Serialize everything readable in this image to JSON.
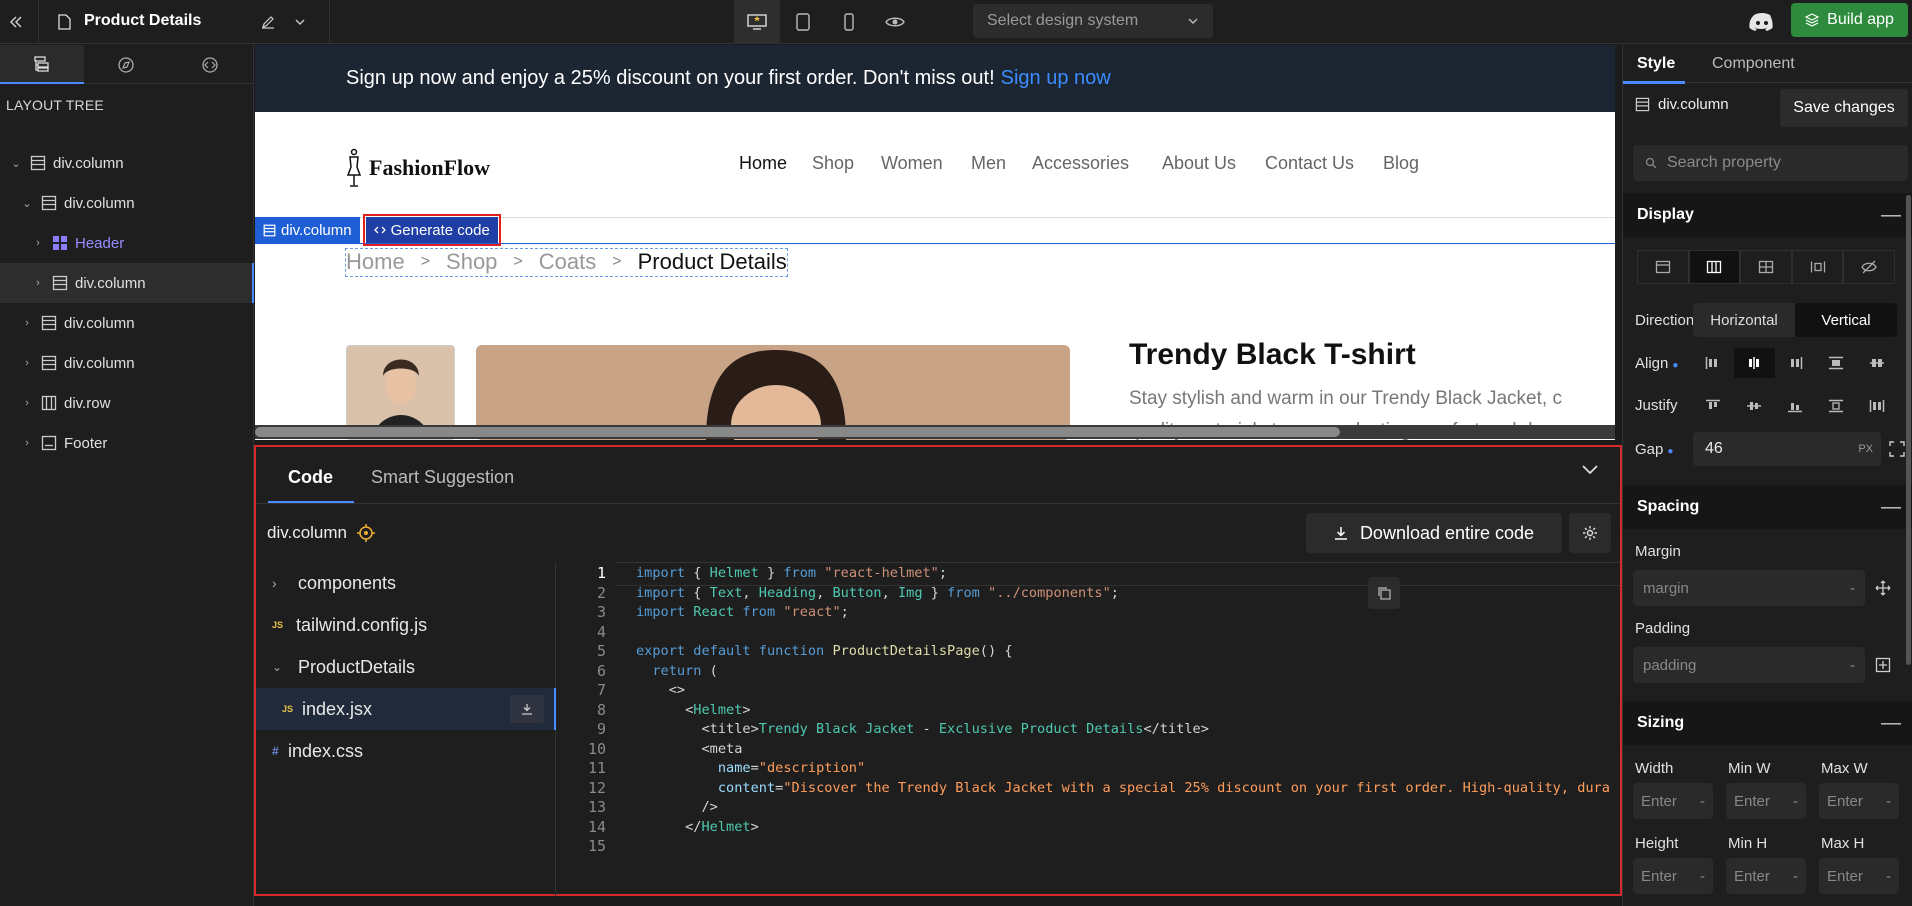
{
  "topbar": {
    "page_title": "Product Details",
    "design_system_placeholder": "Select design system",
    "build_label": "Build app"
  },
  "left": {
    "layout_tree_title": "LAYOUT TREE",
    "tree": [
      {
        "label": "div.column",
        "depth": 0
      },
      {
        "label": "div.column",
        "depth": 1
      },
      {
        "label": "Header",
        "depth": 2
      },
      {
        "label": "div.column",
        "depth": 2
      },
      {
        "label": "div.column",
        "depth": 1
      },
      {
        "label": "div.column",
        "depth": 1
      },
      {
        "label": "div.row",
        "depth": 1
      },
      {
        "label": "Footer",
        "depth": 1
      }
    ]
  },
  "canvas": {
    "promo_text": "Sign up now and enjoy a 25% discount on your first order. Don't miss out!",
    "promo_link": "Sign up now",
    "logo": "FashionFlow",
    "nav": [
      "Home",
      "Shop",
      "Women",
      "Men",
      "Accessories",
      "About Us",
      "Contact Us",
      "Blog"
    ],
    "selection_tag": "div.column",
    "generate_code": "Generate code",
    "breadcrumb": [
      "Home",
      "Shop",
      "Coats",
      "Product Details"
    ],
    "product_title": "Trendy Black T-shirt",
    "product_desc": "Stay stylish and warm in our Trendy Black Jacket, c",
    "product_desc2": "quality materials to ensure lasting comfort and dura"
  },
  "code_panel": {
    "tab_code": "Code",
    "tab_smart": "Smart Suggestion",
    "node_label": "div.column",
    "download_label": "Download entire code",
    "files": [
      {
        "name": "components",
        "type": "folder"
      },
      {
        "name": "tailwind.config.js",
        "type": "js"
      },
      {
        "name": "ProductDetails",
        "type": "folder-open"
      },
      {
        "name": "index.jsx",
        "type": "js"
      },
      {
        "name": "index.css",
        "type": "css"
      }
    ],
    "file_icons": {
      "js": "JS",
      "css": "#"
    },
    "line_numbers": [
      "1",
      "2",
      "3",
      "4",
      "5",
      "6",
      "7",
      "8",
      "9",
      "10",
      "11",
      "12",
      "13",
      "14",
      "15"
    ]
  },
  "right": {
    "tab_style": "Style",
    "tab_component": "Component",
    "node_label": "div.column",
    "save_label": "Save changes",
    "search_placeholder": "Search property",
    "display_title": "Display",
    "direction_label": "Direction",
    "dir_horizontal": "Horizontal",
    "dir_vertical": "Vertical",
    "align_label": "Align",
    "justify_label": "Justify",
    "gap_label": "Gap",
    "gap_value": "46",
    "gap_unit": "PX",
    "spacing_title": "Spacing",
    "margin_label": "Margin",
    "margin_placeholder": "margin",
    "padding_label": "Padding",
    "padding_placeholder": "padding",
    "sizing_title": "Sizing",
    "width_label": "Width",
    "minw_label": "Min W",
    "maxw_label": "Max W",
    "height_label": "Height",
    "minh_label": "Min H",
    "maxh_label": "Max H",
    "enter_placeholder": "Enter",
    "dash": "-",
    "minus": "—"
  },
  "colors": {
    "accent": "#4a8cff",
    "build": "#2e8b3d",
    "highlight_border": "#d42a2a"
  }
}
